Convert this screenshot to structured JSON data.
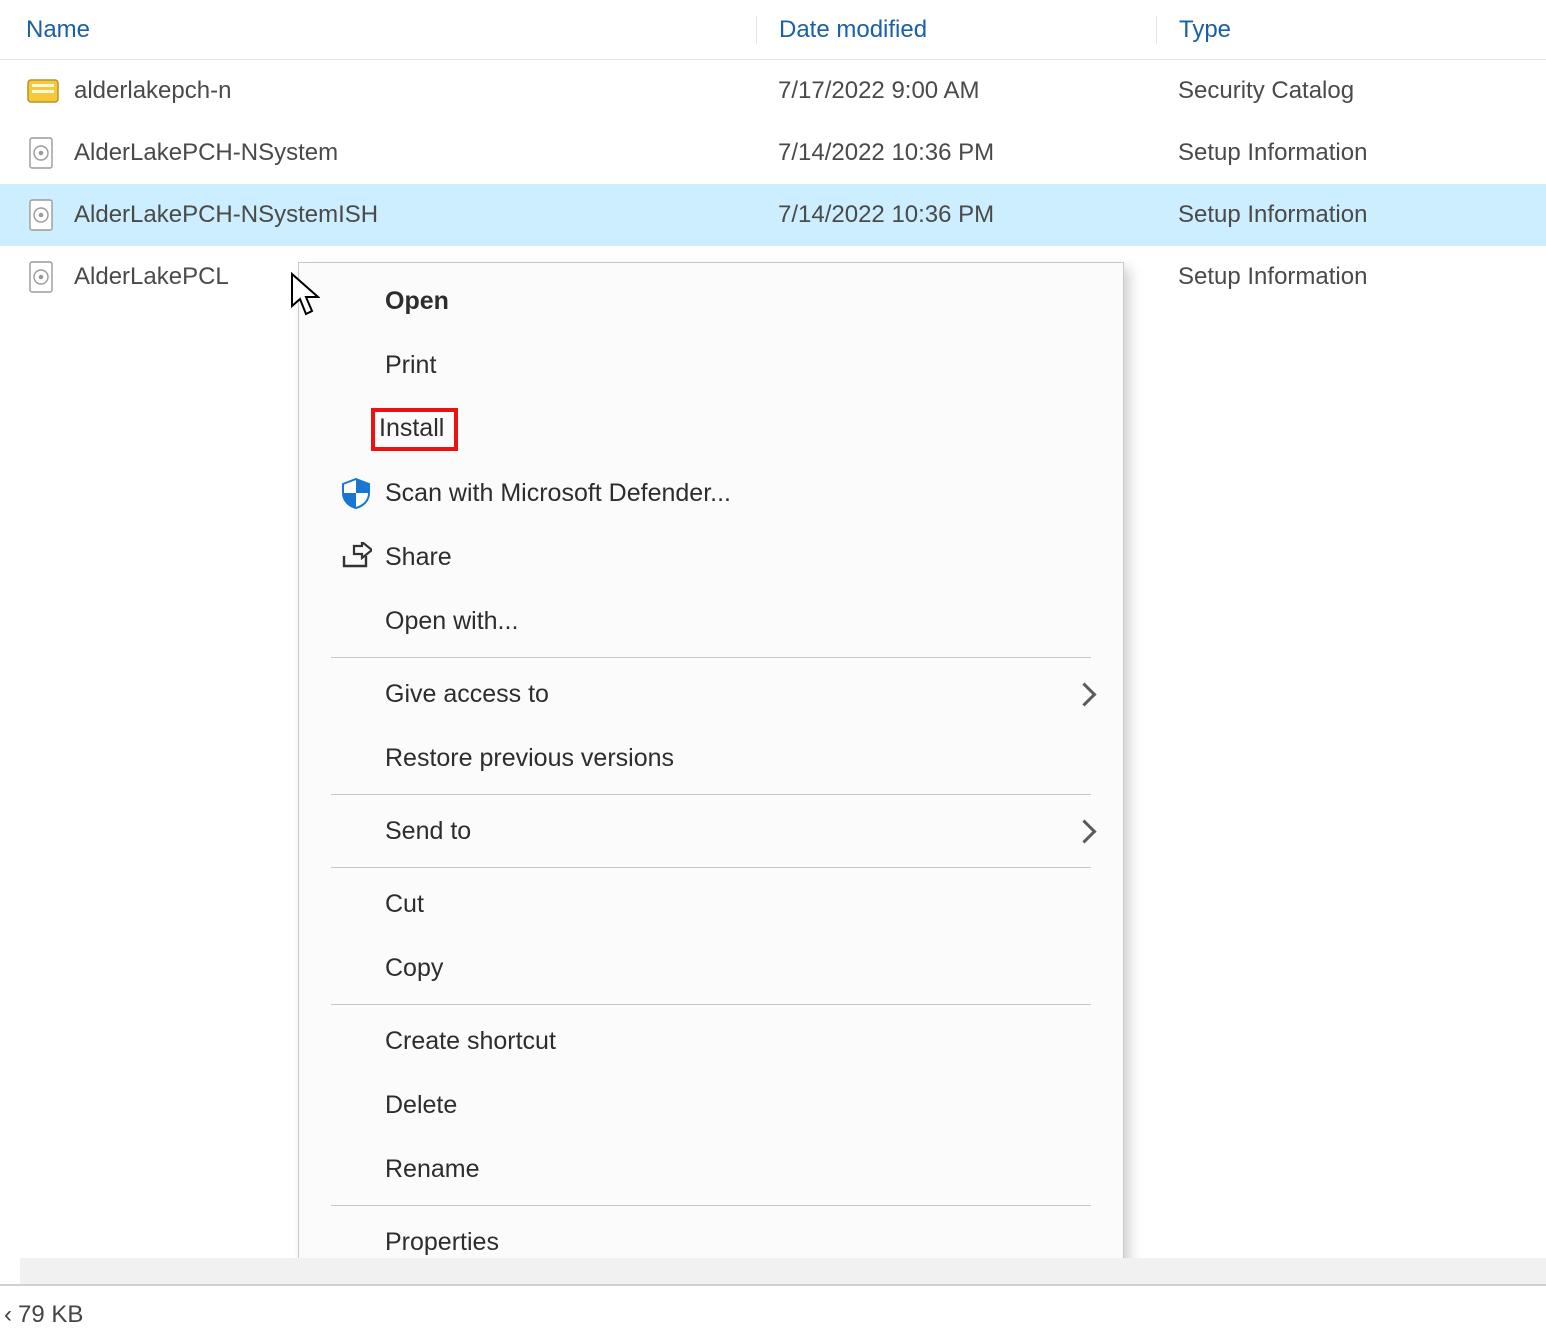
{
  "columns": {
    "name": "Name",
    "date": "Date modified",
    "type": "Type"
  },
  "files": [
    {
      "icon": "cat",
      "name": "alderlakepch-n",
      "date": "7/17/2022 9:00 AM",
      "type": "Security Catalog",
      "selected": false
    },
    {
      "icon": "inf",
      "name": "AlderLakePCH-NSystem",
      "date": "7/14/2022 10:36 PM",
      "type": "Setup Information",
      "selected": false
    },
    {
      "icon": "inf",
      "name": "AlderLakePCH-NSystemISH",
      "date": "7/14/2022 10:36 PM",
      "type": "Setup Information",
      "selected": true
    },
    {
      "icon": "inf",
      "name": "AlderLakePCL",
      "date": "",
      "type": "Setup Information",
      "selected": false
    }
  ],
  "statusbar": {
    "size": "79 KB",
    "truncated_left": "‹"
  },
  "context_menu": {
    "open": "Open",
    "print": "Print",
    "install": "Install",
    "defender": "Scan with Microsoft Defender...",
    "share": "Share",
    "open_with": "Open with...",
    "give_access": "Give access to",
    "restore": "Restore previous versions",
    "send_to": "Send to",
    "cut": "Cut",
    "copy": "Copy",
    "create_shortcut": "Create shortcut",
    "delete": "Delete",
    "rename": "Rename",
    "properties": "Properties"
  },
  "highlight": "install"
}
